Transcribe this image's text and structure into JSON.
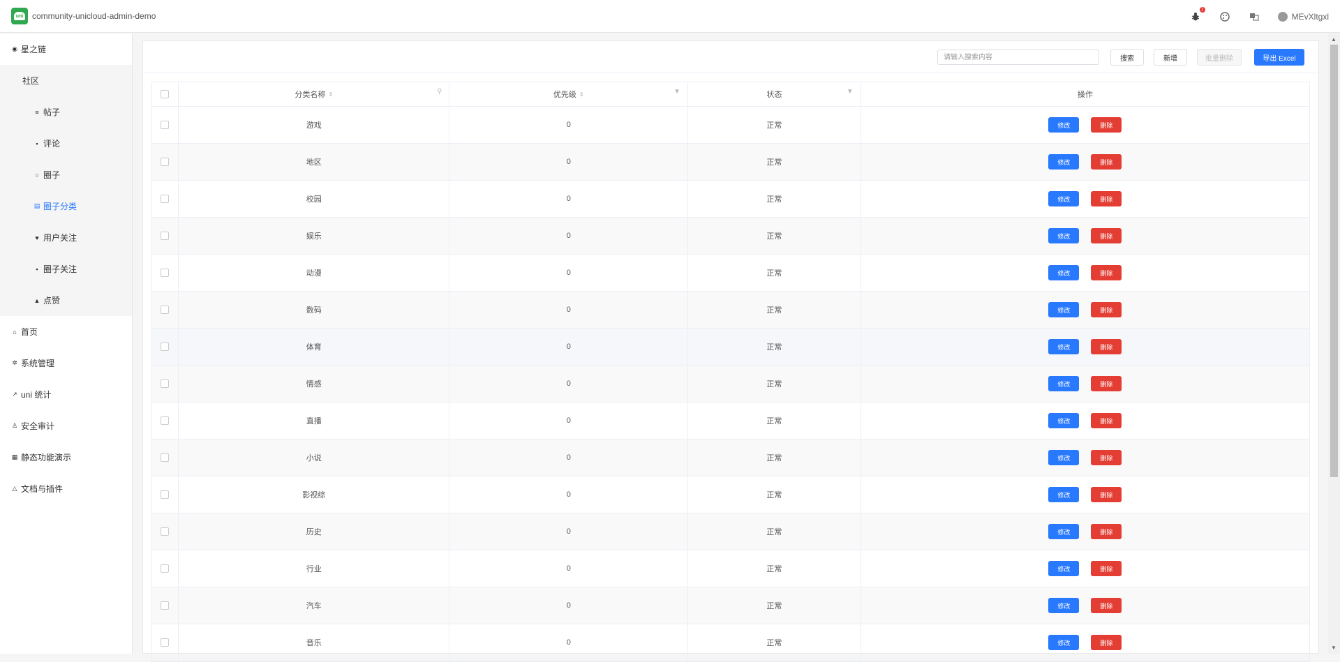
{
  "app": {
    "title": "community-unicloud-admin-demo",
    "logo_text": "uni"
  },
  "topbar": {
    "bug_badge": "1",
    "user_name": "MEvXltgxl"
  },
  "sidebar": {
    "top": {
      "label": "星之链",
      "icon": "dot-icon"
    },
    "group": {
      "label": "社区"
    },
    "sub_items": [
      {
        "label": "帖子",
        "icon": "list-icon"
      },
      {
        "label": "评论",
        "icon": "comment-icon"
      },
      {
        "label": "圈子",
        "icon": "circle-icon"
      },
      {
        "label": "圈子分类",
        "icon": "map-icon",
        "active": true
      },
      {
        "label": "用户关注",
        "icon": "heart-icon"
      },
      {
        "label": "圈子关注",
        "icon": "chat-icon"
      },
      {
        "label": "点赞",
        "icon": "thumb-icon"
      }
    ],
    "items": [
      {
        "label": "首页",
        "icon": "home-icon"
      },
      {
        "label": "系统管理",
        "icon": "gear-icon"
      },
      {
        "label": "uni 统计",
        "icon": "chart-icon"
      },
      {
        "label": "安全审计",
        "icon": "person-icon"
      },
      {
        "label": "静态功能演示",
        "icon": "grid-icon"
      },
      {
        "label": "文档与插件",
        "icon": "bell-icon"
      }
    ]
  },
  "toolbar": {
    "search_placeholder": "请输入搜索内容",
    "search_label": "搜索",
    "add_label": "新增",
    "batch_delete_label": "批量删除",
    "export_label": "导出 Excel"
  },
  "table": {
    "headers": {
      "name": "分类名称",
      "priority": "优先级",
      "status": "状态",
      "actions": "操作"
    },
    "edit_label": "修改",
    "delete_label": "删除",
    "rows": [
      {
        "name": "游戏",
        "priority": "0",
        "status": "正常"
      },
      {
        "name": "地区",
        "priority": "0",
        "status": "正常"
      },
      {
        "name": "校园",
        "priority": "0",
        "status": "正常"
      },
      {
        "name": "娱乐",
        "priority": "0",
        "status": "正常"
      },
      {
        "name": "动漫",
        "priority": "0",
        "status": "正常"
      },
      {
        "name": "数码",
        "priority": "0",
        "status": "正常"
      },
      {
        "name": "体育",
        "priority": "0",
        "status": "正常"
      },
      {
        "name": "情感",
        "priority": "0",
        "status": "正常"
      },
      {
        "name": "直播",
        "priority": "0",
        "status": "正常"
      },
      {
        "name": "小说",
        "priority": "0",
        "status": "正常"
      },
      {
        "name": "影视综",
        "priority": "0",
        "status": "正常"
      },
      {
        "name": "历史",
        "priority": "0",
        "status": "正常"
      },
      {
        "name": "行业",
        "priority": "0",
        "status": "正常"
      },
      {
        "name": "汽车",
        "priority": "0",
        "status": "正常"
      },
      {
        "name": "音乐",
        "priority": "0",
        "status": "正常"
      }
    ]
  }
}
